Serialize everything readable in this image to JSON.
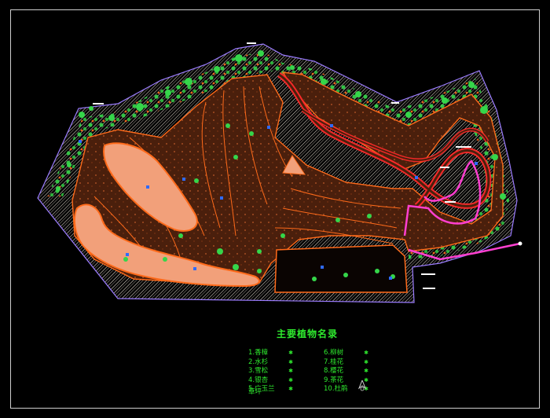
{
  "drawing": {
    "legend_title": "主要植物名录",
    "legend_left": [
      {
        "label": "1.香樟",
        "symbol": "✱"
      },
      {
        "label": "2.水杉",
        "symbol": "✱"
      },
      {
        "label": "3.雪松",
        "symbol": "✱"
      },
      {
        "label": "4.银杏",
        "symbol": "✱"
      },
      {
        "label": "5.广玉兰",
        "symbol": "✱"
      }
    ],
    "legend_right": [
      {
        "label": "6.柳树",
        "symbol": "✱"
      },
      {
        "label": "7.桂花",
        "symbol": "✱"
      },
      {
        "label": "8.樱花",
        "symbol": "✱"
      },
      {
        "label": "9.茶花",
        "symbol": "✱"
      },
      {
        "label": "10.杜鹃",
        "symbol": "✱"
      }
    ],
    "legend_tail": "草坪"
  },
  "colors": {
    "background": "#000000",
    "site_outline": "#9b7cff",
    "hedge_hatch": "#d8d0c4",
    "fairway": "#4a1f0c",
    "fairway_edge": "#ff6a1a",
    "sand_lake": "#f2a07a",
    "tree_green": "#35d64a",
    "cart_path": "#ff3fd0",
    "red_line": "#ff2a2a",
    "legend_text": "#2ee82e"
  }
}
